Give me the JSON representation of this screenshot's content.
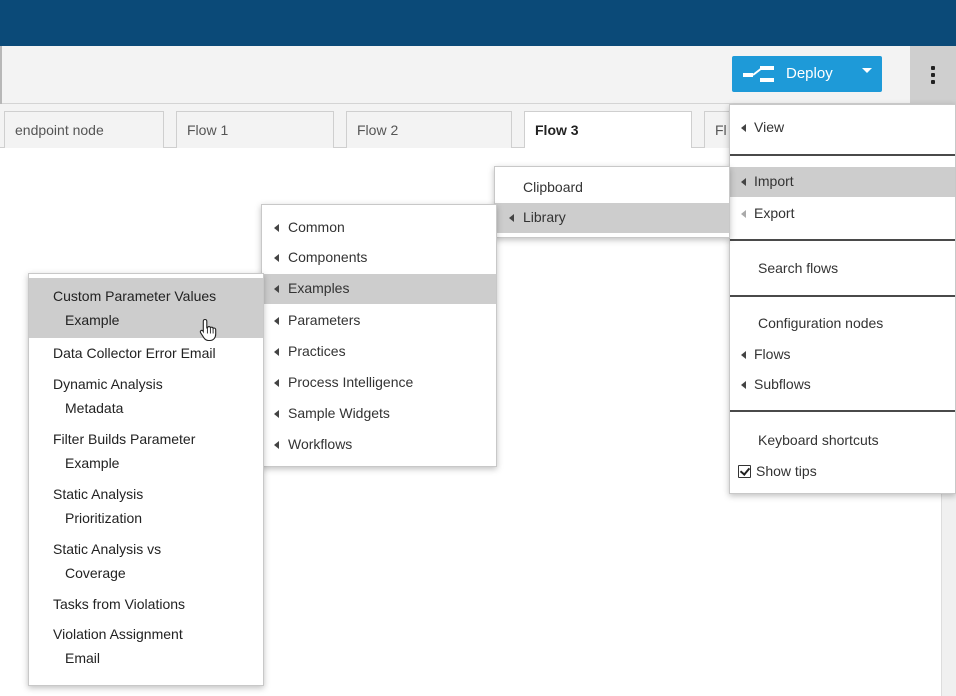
{
  "header": {
    "deploy_label": "Deploy"
  },
  "tabs": [
    {
      "label": "endpoint node"
    },
    {
      "label": "Flow 1"
    },
    {
      "label": "Flow 2"
    },
    {
      "label": "Flow 3"
    },
    {
      "label": "Fl"
    }
  ],
  "main_menu": {
    "view": "View",
    "import": "Import",
    "export": "Export",
    "search_flows": "Search flows",
    "configuration_nodes": "Configuration nodes",
    "flows": "Flows",
    "subflows": "Subflows",
    "keyboard_shortcuts": "Keyboard shortcuts",
    "show_tips": "Show tips"
  },
  "import_menu": {
    "clipboard": "Clipboard",
    "library": "Library"
  },
  "library_menu": [
    {
      "label": "Common"
    },
    {
      "label": "Components"
    },
    {
      "label": "Examples"
    },
    {
      "label": "Parameters"
    },
    {
      "label": "Practices"
    },
    {
      "label": "Process Intelligence"
    },
    {
      "label": "Sample Widgets"
    },
    {
      "label": "Workflows"
    }
  ],
  "examples_menu": [
    {
      "line1": "Custom Parameter Values",
      "line2": "Example"
    },
    {
      "line1": "Data Collector Error Email",
      "line2": ""
    },
    {
      "line1": "Dynamic Analysis",
      "line2": "Metadata"
    },
    {
      "line1": "Filter Builds Parameter",
      "line2": "Example"
    },
    {
      "line1": "Static Analysis",
      "line2": "Prioritization"
    },
    {
      "line1": "Static Analysis vs",
      "line2": "Coverage"
    },
    {
      "line1": "Tasks from Violations",
      "line2": ""
    },
    {
      "line1": "Violation Assignment",
      "line2": "Email"
    }
  ]
}
